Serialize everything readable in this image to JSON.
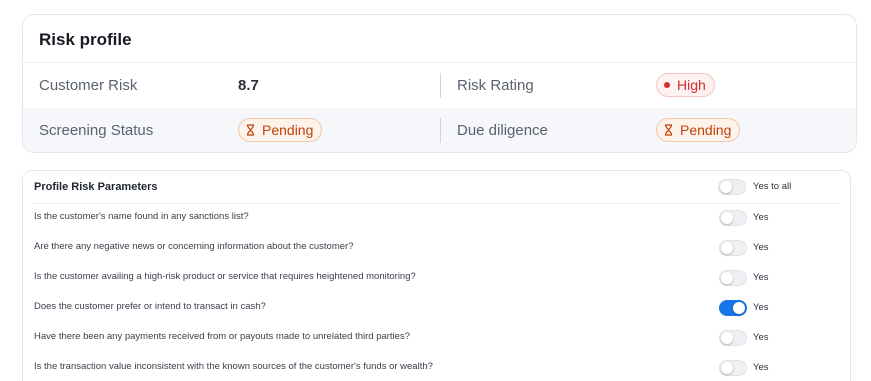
{
  "risk_profile": {
    "title": "Risk profile",
    "customer_risk_label": "Customer Risk",
    "customer_risk_value": "8.7",
    "risk_rating_label": "Risk Rating",
    "risk_rating_value": "High",
    "screening_status_label": "Screening Status",
    "screening_status_value": "Pending",
    "due_diligence_label": "Due diligence",
    "due_diligence_value": "Pending"
  },
  "parameters": {
    "title": "Profile Risk Parameters",
    "yes_to_all_label": "Yes to all",
    "yes_to_all_on": false,
    "questions": [
      {
        "text": "Is the customer's name found in any sanctions list?",
        "answer_label": "Yes",
        "on": false
      },
      {
        "text": "Are there any negative news or concerning information about the customer?",
        "answer_label": "Yes",
        "on": false
      },
      {
        "text": "Is the customer availing a high-risk product or service that requires heightened monitoring?",
        "answer_label": "Yes",
        "on": false
      },
      {
        "text": "Does the customer prefer or intend to transact in cash?",
        "answer_label": "Yes",
        "on": true
      },
      {
        "text": "Have there been any payments received from or payouts made to unrelated third parties?",
        "answer_label": "Yes",
        "on": false
      },
      {
        "text": "Is the transaction value inconsistent with the known sources of the customer's funds or wealth?",
        "answer_label": "Yes",
        "on": false
      }
    ]
  },
  "colors": {
    "toggle_on": "#1576e6",
    "high_badge": "#d32f2f",
    "pending_badge": "#c2410c"
  }
}
